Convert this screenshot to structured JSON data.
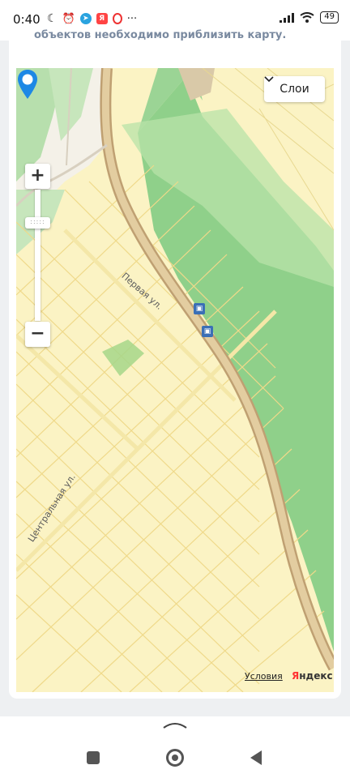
{
  "status_bar": {
    "time": "0:40",
    "battery": "49",
    "icons": [
      "moon-icon",
      "alarm-icon",
      "telegram-icon",
      "yandex-icon",
      "opera-icon",
      "more-icon",
      "signal-icon",
      "wifi-icon",
      "battery-icon"
    ],
    "more": "···"
  },
  "notice": {
    "text": "объектов необходимо приблизить карту."
  },
  "map": {
    "layers_label": "Слои",
    "zoom_in": "+",
    "zoom_out": "−",
    "zoom_handle": ":::::",
    "streets": [
      "Первая ул.",
      "Центральная ул."
    ],
    "terms_link": "Условия",
    "brand_first": "Я",
    "brand_rest": "ндекс",
    "colors": {
      "land": "#fbf3c4",
      "forest": "#8fd08a",
      "road": "#d6b98e",
      "parcel_lines": "#f0dc8c",
      "pin": "#1e88e5"
    }
  }
}
